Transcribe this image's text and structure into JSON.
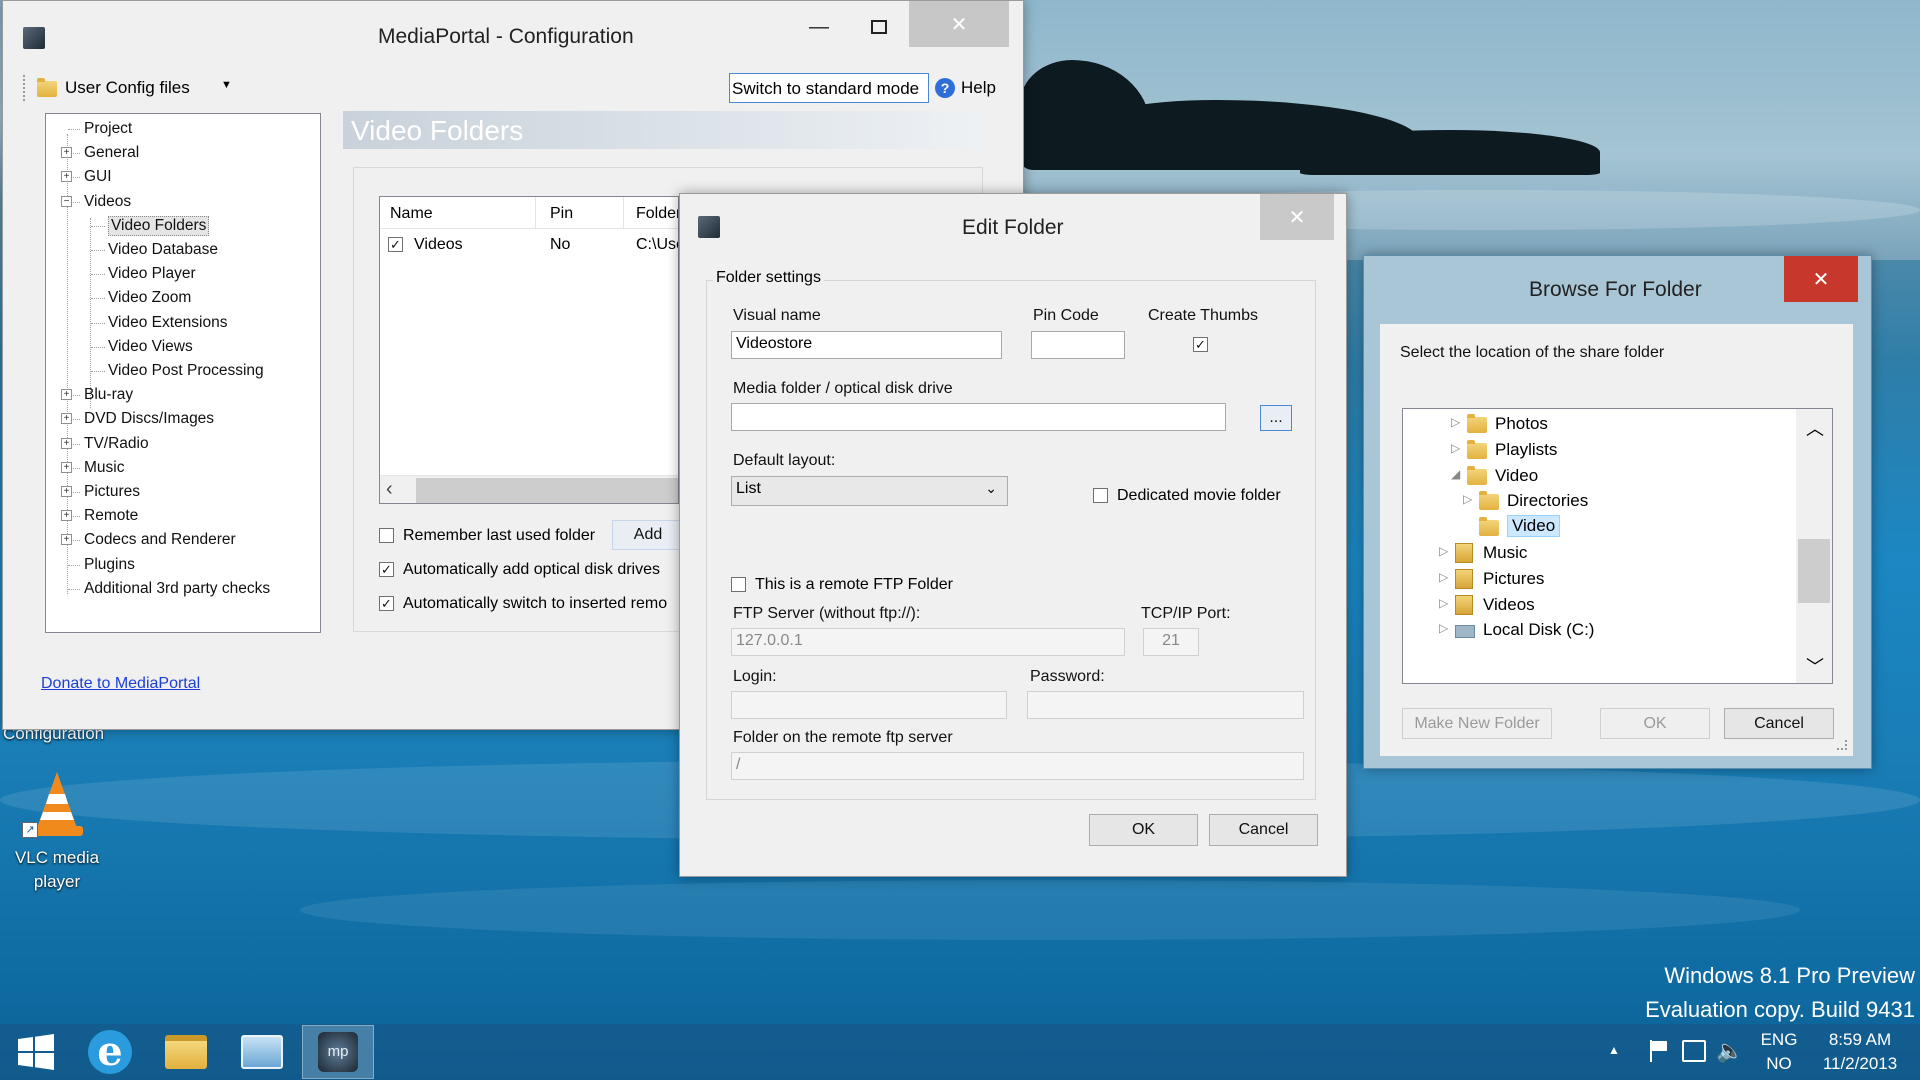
{
  "desktop": {
    "watermark_line1": "Windows 8.1 Pro Preview",
    "watermark_line2": "Evaluation copy. Build 9431",
    "icons": [
      {
        "label_line1": "VLC media",
        "label_line2": "player"
      }
    ],
    "partial_label": "Configuration"
  },
  "mediaportal": {
    "title": "MediaPortal - Configuration",
    "toolbar": {
      "config_files": "User Config files",
      "switch_mode": "Switch to standard mode",
      "help": "Help"
    },
    "tree": [
      {
        "label": "Project",
        "expander": ""
      },
      {
        "label": "General",
        "expander": "+"
      },
      {
        "label": "GUI",
        "expander": "+"
      },
      {
        "label": "Videos",
        "expander": "−"
      },
      {
        "label": "Video Folders",
        "child": true,
        "selected": true
      },
      {
        "label": "Video Database",
        "child": true
      },
      {
        "label": "Video Player",
        "child": true
      },
      {
        "label": "Video Zoom",
        "child": true
      },
      {
        "label": "Video Extensions",
        "child": true
      },
      {
        "label": "Video Views",
        "child": true
      },
      {
        "label": "Video Post Processing",
        "child": true
      },
      {
        "label": "Blu-ray",
        "expander": "+"
      },
      {
        "label": "DVD Discs/Images",
        "expander": "+"
      },
      {
        "label": "TV/Radio",
        "expander": "+"
      },
      {
        "label": "Music",
        "expander": "+"
      },
      {
        "label": "Pictures",
        "expander": "+"
      },
      {
        "label": "Remote",
        "expander": "+"
      },
      {
        "label": "Codecs and Renderer",
        "expander": "+"
      },
      {
        "label": "Plugins",
        "expander": ""
      },
      {
        "label": "Additional 3rd party checks",
        "expander": ""
      }
    ],
    "section_title": "Video Folders",
    "list": {
      "columns": [
        "Name",
        "Pin",
        "Folder"
      ],
      "rows": [
        {
          "name": "Videos",
          "pin": "No",
          "folder": "C:\\Use",
          "checked": true
        }
      ]
    },
    "options": [
      {
        "label": "Remember last used folder",
        "checked": false
      },
      {
        "label": "Automatically add optical disk drives",
        "checked": true
      },
      {
        "label": "Automatically switch to inserted remo",
        "checked": true
      }
    ],
    "add_button": "Add",
    "donate_link": "Donate to MediaPortal"
  },
  "edit_folder": {
    "title": "Edit Folder",
    "group_title": "Folder settings",
    "visual_name_label": "Visual name",
    "visual_name_value": "Videostore",
    "pin_code_label": "Pin Code",
    "pin_code_value": "",
    "create_thumbs_label": "Create Thumbs",
    "create_thumbs_checked": true,
    "media_folder_label": "Media folder / optical disk drive",
    "media_folder_value": "",
    "browse_button": "...",
    "default_layout_label": "Default layout:",
    "default_layout_value": "List",
    "dedicated_label": "Dedicated movie folder",
    "dedicated_checked": false,
    "remote_ftp_label": "This is a remote FTP Folder",
    "remote_ftp_checked": false,
    "ftp_server_label": "FTP Server (without ftp://):",
    "ftp_server_value": "127.0.0.1",
    "port_label": "TCP/IP Port:",
    "port_value": "21",
    "login_label": "Login:",
    "login_value": "",
    "password_label": "Password:",
    "password_value": "",
    "remote_folder_label": "Folder on the remote ftp server",
    "remote_folder_value": "/",
    "ok_button": "OK",
    "cancel_button": "Cancel"
  },
  "browse_folder": {
    "title": "Browse For Folder",
    "prompt": "Select the location of the share folder",
    "items": [
      {
        "label": "Photos",
        "arrow": "▷",
        "icon": "folder"
      },
      {
        "label": "Playlists",
        "arrow": "▷",
        "icon": "folder"
      },
      {
        "label": "Video",
        "arrow": "◢",
        "icon": "folder"
      },
      {
        "label": "Directories",
        "arrow": "▷",
        "icon": "folder"
      },
      {
        "label": "Video",
        "arrow": "",
        "icon": "folder",
        "selected": true
      },
      {
        "label": "Music",
        "arrow": "▷",
        "icon": "library"
      },
      {
        "label": "Pictures",
        "arrow": "▷",
        "icon": "library"
      },
      {
        "label": "Videos",
        "arrow": "▷",
        "icon": "library"
      },
      {
        "label": "Local Disk (C:)",
        "arrow": "▷",
        "icon": "drive"
      }
    ],
    "make_new_folder": "Make New Folder",
    "ok_button": "OK",
    "cancel_button": "Cancel"
  },
  "taskbar": {
    "lang_top": "ENG",
    "lang_bottom": "NO",
    "time": "8:59 AM",
    "date": "11/2/2013"
  }
}
